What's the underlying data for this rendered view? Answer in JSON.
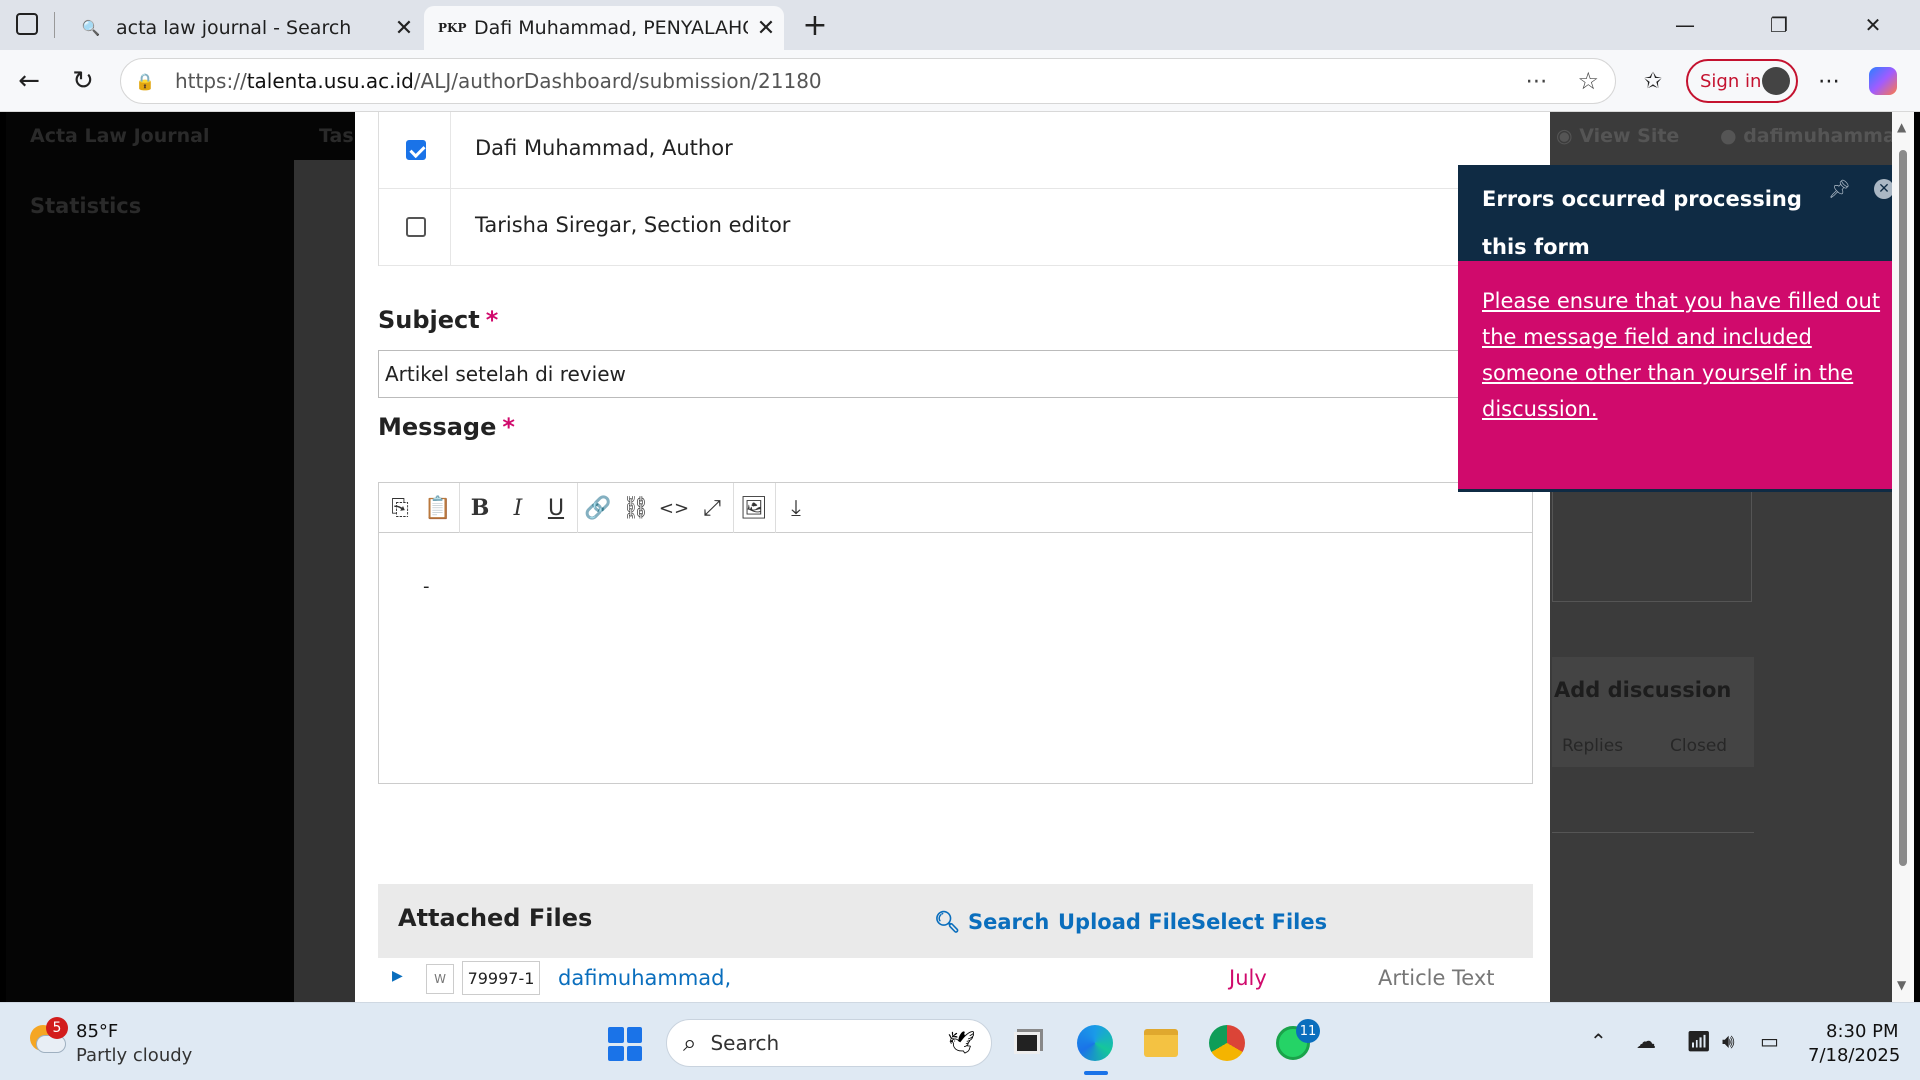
{
  "browser": {
    "tabs": [
      {
        "title": "acta law journal - Search",
        "icon": "search-icon"
      },
      {
        "title": "Dafi Muhammad, PENYALAHGUN",
        "icon": "pkp-favicon",
        "favicon_text": "PKP"
      }
    ],
    "url_prefix": "https://",
    "url_host": "talenta.usu.ac.id",
    "url_path": "/ALJ/authorDashboard/submission/21180",
    "sign_in_label": "Sign in"
  },
  "page": {
    "journal_name": "Acta Law Journal",
    "tasks_label": "Tas",
    "statistics_label": "Statistics",
    "view_site_label": "View Site",
    "user_label": "dafimuhammad",
    "add_discussion_title": "Add discussion",
    "replies_label": "Replies",
    "closed_label": "Closed"
  },
  "form": {
    "participants": [
      {
        "name": "Dafi Muhammad, Author",
        "checked": true
      },
      {
        "name": "Tarisha Siregar, Section editor",
        "checked": false
      }
    ],
    "subject_label": "Subject",
    "subject_value": "Artikel setelah di review",
    "message_label": "Message",
    "required_marker": "*",
    "message_value": "-",
    "toolbar_icons": [
      "copy-icon",
      "paste-icon",
      "bold-icon",
      "italic-icon",
      "underline-icon",
      "link-icon",
      "unlink-icon",
      "code-icon",
      "fullscreen-icon",
      "image-icon",
      "upload-icon"
    ],
    "attached_files_title": "Attached Files",
    "search_label": "Search",
    "upload_label": "Upload File",
    "select_label": "Select Files",
    "file": {
      "id": "79997-1",
      "name": "dafimuhammad,",
      "date": "July",
      "kind": "Article Text"
    }
  },
  "error": {
    "title": "Errors occurred processing this form",
    "message": "Please ensure that you have filled out the message field and included someone other than yourself in the discussion."
  },
  "taskbar": {
    "weather_badge": "5",
    "temperature": "85°F",
    "weather": "Partly cloudy",
    "search_label": "Search",
    "whatsapp_badge": "11",
    "time": "8:30 PM",
    "date": "7/18/2025"
  },
  "colors": {
    "accent": "#d00a6c",
    "header_navy": "#0f2b44",
    "link_blue": "#0a6ebd"
  }
}
